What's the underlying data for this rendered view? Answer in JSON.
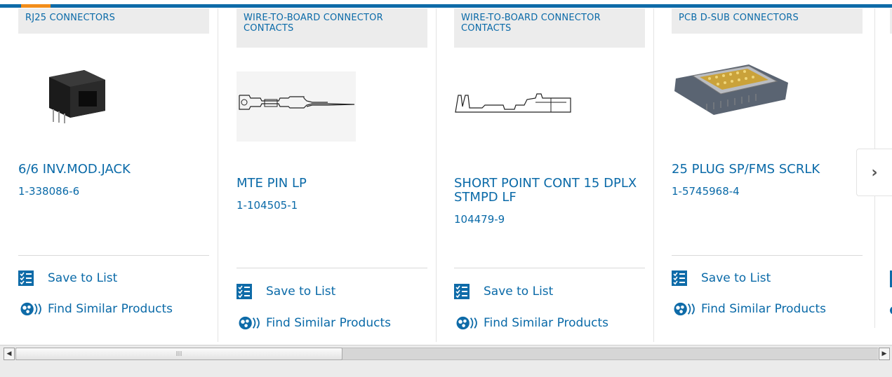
{
  "carousel": {
    "cards": [
      {
        "category": "RJ25 CONNECTORS",
        "title": "6/6 INV.MOD.JACK",
        "part_number": "1-338086-6",
        "image": "rj25-jack-image",
        "save_label": "Save to List",
        "find_label": "Find Similar Products"
      },
      {
        "category": "WIRE-TO-BOARD CONNECTOR CONTACTS",
        "title": "MTE PIN LP",
        "part_number": "1-104505-1",
        "image": "pin-contact-drawing",
        "save_label": "Save to List",
        "find_label": "Find Similar Products"
      },
      {
        "category": "WIRE-TO-BOARD CONNECTOR CONTACTS",
        "title": "SHORT POINT CONT 15 DPLX STMPD LF",
        "part_number": "104479-9",
        "image": "socket-contact-drawing",
        "save_label": "Save to List",
        "find_label": "Find Similar Products"
      },
      {
        "category": "PCB D-SUB CONNECTORS",
        "title": "25 PLUG SP/FMS SCRLK",
        "part_number": "1-5745968-4",
        "image": "dsub-connector-image",
        "save_label": "Save to List",
        "find_label": "Find Similar Products"
      }
    ],
    "next_icon": "chevron-right-icon",
    "next_glyph": "›",
    "accent_color": "#0a6aa8",
    "highlight_color": "#f28d1a"
  },
  "scrollbar": {
    "left_arrow": "◀",
    "right_arrow": "▶",
    "grip": "III"
  }
}
